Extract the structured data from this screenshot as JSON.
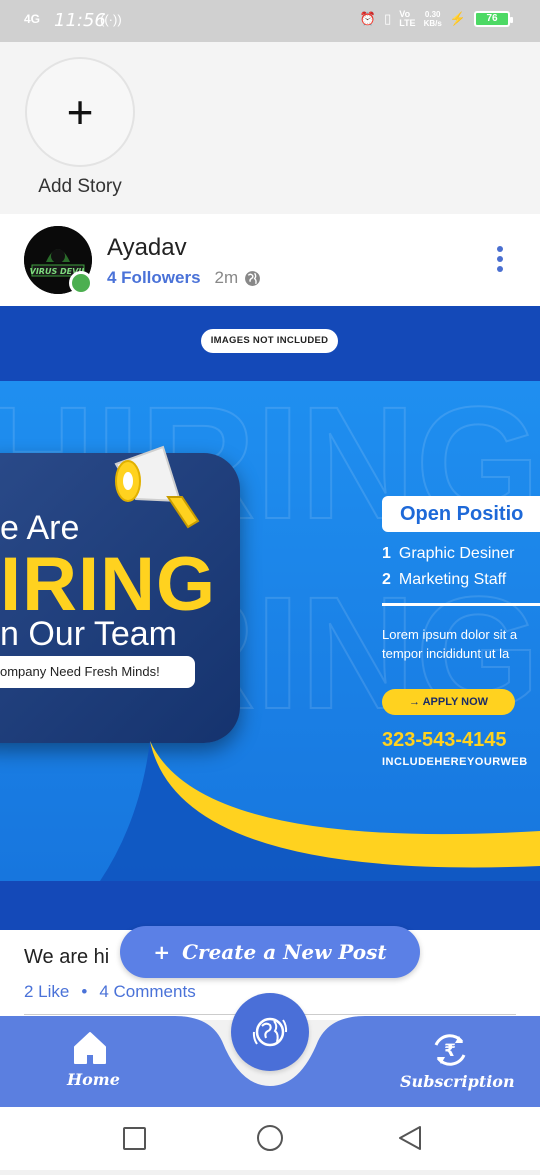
{
  "status_bar": {
    "network": "4G",
    "time": "11:56",
    "volte": "Vo))\nLTE",
    "speed": "0.30\nKB/s",
    "battery": "76"
  },
  "stories": {
    "add_label": "Add Story"
  },
  "post": {
    "author": "Ayadav",
    "avatar_text": "VIRUS DEVIL",
    "followers": "4 Followers",
    "time_ago": "2m",
    "image": {
      "note": "IMAGES NOT INCLUDED",
      "we_are": "e Are",
      "hiring": "IRING",
      "our_team": "n Our Team",
      "fresh": "ompany Need Fresh Minds!",
      "open_positions": "Open Positio",
      "position_1_num": "1",
      "position_1": "Graphic Desiner",
      "position_2_num": "2",
      "position_2": "Marketing Staff",
      "lorem_1": "Lorem ipsum dolor sit a",
      "lorem_2": "tempor incididunt ut la",
      "apply": "→   APPLY NOW",
      "phone": "323-543-4145",
      "website": "INCLUDEHEREYOURWEB"
    },
    "caption": "We are hi",
    "likes": "2 Like",
    "dot": "•",
    "comments": "4 Comments"
  },
  "create_post": {
    "plus": "+",
    "label": "Create a New Post"
  },
  "bottom_nav": {
    "home": "Home",
    "subscription": "Subscription"
  },
  "colors": {
    "accent": "#4a6fd8",
    "nav_bg": "#5b7fe0",
    "online": "#4caf50",
    "hiring_yellow": "#ffd21f"
  }
}
